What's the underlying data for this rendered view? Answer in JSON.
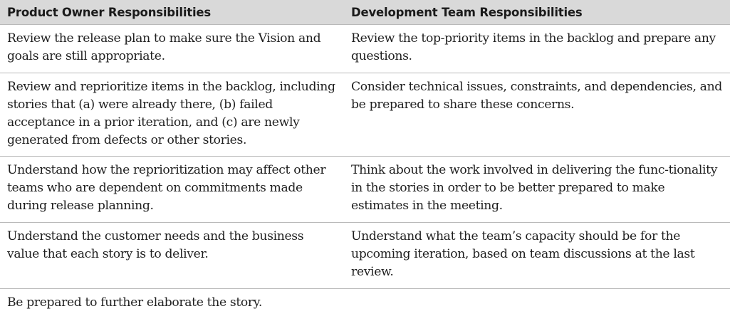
{
  "headers": {
    "left": "Product Owner Responsibilities",
    "right": "Development Team Responsibilities"
  },
  "rows": [
    {
      "left": "Review the release plan to make sure the Vision and goals are still appropriate.",
      "right": "Review the top-priority items in the backlog and prepare any questions."
    },
    {
      "left": "Review and reprioritize items in the backlog, including stories that (a) were already there, (b) failed acceptance in a prior iteration, and (c) are newly generated from defects or other stories.",
      "right": "Consider technical issues, constraints, and dependencies, and be prepared to share these concerns."
    },
    {
      "left": "Understand how the reprioritization may affect other teams who are dependent on commitments made during release planning.",
      "right": "Think about the work involved in delivering the func-tionality in the stories in order to be better prepared to make estimates in the meeting."
    },
    {
      "left": "Understand the customer needs and the business value that each story is to deliver.",
      "right": "Understand what the team’s capacity should be for the upcoming iteration, based on team discussions at the last review."
    },
    {
      "left": "Be prepared to further elaborate the story.",
      "right": ""
    }
  ]
}
